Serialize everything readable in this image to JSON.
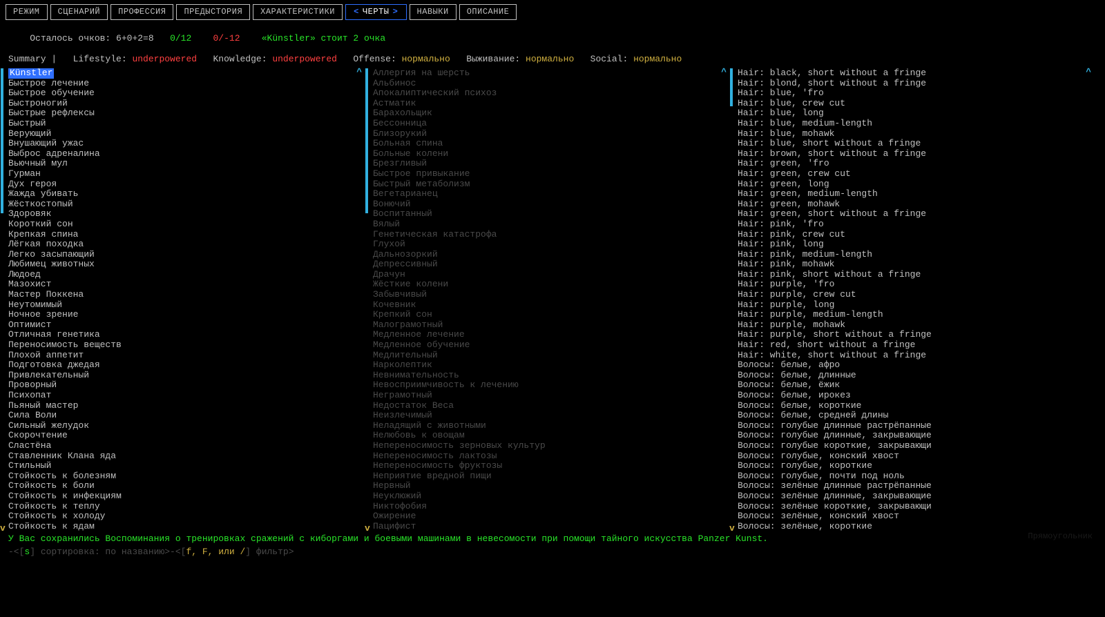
{
  "tabs": [
    {
      "label": "РЕЖИМ",
      "active": false
    },
    {
      "label": "СЦЕНАРИЙ",
      "active": false
    },
    {
      "label": "ПРОФЕССИЯ",
      "active": false
    },
    {
      "label": "ПРЕДЫСТОРИЯ",
      "active": false
    },
    {
      "label": "ХАРАКТЕРИСТИКИ",
      "active": false
    },
    {
      "label": "ЧЕРТЫ",
      "active": true
    },
    {
      "label": "НАВЫКИ",
      "active": false
    },
    {
      "label": "ОПИСАНИЕ",
      "active": false
    }
  ],
  "points": {
    "label": "Осталось очков: ",
    "expr": "6+0+2=8",
    "pos": "0/12",
    "neg": "0/-12",
    "cost": "«Künstler» стоит 2 очка"
  },
  "summary": {
    "prefix": "Summary |",
    "items": [
      {
        "k": "Lifestyle:",
        "v": "underpowered",
        "cls": "r"
      },
      {
        "k": "Knowledge:",
        "v": "underpowered",
        "cls": "r"
      },
      {
        "k": "Offense:",
        "v": "нормально",
        "cls": "y"
      },
      {
        "k": "Выживание:",
        "v": "нормально",
        "cls": "y"
      },
      {
        "k": "Social:",
        "v": "нормально",
        "cls": "y"
      }
    ]
  },
  "columns": {
    "positive": [
      {
        "t": "Künstler",
        "sel": true
      },
      {
        "t": "Быстрое лечение"
      },
      {
        "t": "Быстрое обучение"
      },
      {
        "t": "Быстроногий"
      },
      {
        "t": "Быстрые рефлексы"
      },
      {
        "t": "Быстрый"
      },
      {
        "t": "Верующий"
      },
      {
        "t": "Внушающий ужас"
      },
      {
        "t": "Выброс адреналина"
      },
      {
        "t": "Вьючный мул"
      },
      {
        "t": "Гурман"
      },
      {
        "t": "Дух героя"
      },
      {
        "t": "Жажда убивать"
      },
      {
        "t": "Жёсткостопый"
      },
      {
        "t": "Здоровяк"
      },
      {
        "t": "Короткий сон"
      },
      {
        "t": "Крепкая спина"
      },
      {
        "t": "Лёгкая походка"
      },
      {
        "t": "Легко засыпающий"
      },
      {
        "t": "Любимец животных"
      },
      {
        "t": "Людоед"
      },
      {
        "t": "Мазохист"
      },
      {
        "t": "Мастер Поккена"
      },
      {
        "t": "Неутомимый"
      },
      {
        "t": "Ночное зрение"
      },
      {
        "t": "Оптимист"
      },
      {
        "t": "Отличная генетика"
      },
      {
        "t": "Переносимость веществ"
      },
      {
        "t": "Плохой аппетит"
      },
      {
        "t": "Подготовка джедая"
      },
      {
        "t": "Привлекательный"
      },
      {
        "t": "Проворный"
      },
      {
        "t": "Психопат"
      },
      {
        "t": "Пьяный мастер"
      },
      {
        "t": "Сила Воли"
      },
      {
        "t": "Сильный желудок"
      },
      {
        "t": "Скорочтение"
      },
      {
        "t": "Сластёна"
      },
      {
        "t": "Ставленник Клана яда"
      },
      {
        "t": "Стильный"
      },
      {
        "t": "Стойкость к болезням"
      },
      {
        "t": "Стойкость к боли"
      },
      {
        "t": "Стойкость к инфекциям"
      },
      {
        "t": "Стойкость к теплу"
      },
      {
        "t": "Стойкость к холоду"
      },
      {
        "t": "Стойкость к ядам"
      }
    ],
    "negative": [
      {
        "t": "Аллергия на шерсть"
      },
      {
        "t": "Альбинос"
      },
      {
        "t": "Апокалиптический психоз"
      },
      {
        "t": "Астматик"
      },
      {
        "t": "Барахольщик"
      },
      {
        "t": "Бессонница"
      },
      {
        "t": "Близорукий"
      },
      {
        "t": "Больная спина"
      },
      {
        "t": "Больные колени"
      },
      {
        "t": "Брезгливый"
      },
      {
        "t": "Быстрое привыкание"
      },
      {
        "t": "Быстрый метаболизм"
      },
      {
        "t": "Вегетарианец"
      },
      {
        "t": "Вонючий"
      },
      {
        "t": "Воспитанный"
      },
      {
        "t": "Вялый"
      },
      {
        "t": "Генетическая катастрофа"
      },
      {
        "t": "Глухой"
      },
      {
        "t": "Дальнозоркий"
      },
      {
        "t": "Депрессивный"
      },
      {
        "t": "Драчун"
      },
      {
        "t": "Жёсткие колени"
      },
      {
        "t": "Забывчивый"
      },
      {
        "t": "Кочевник"
      },
      {
        "t": "Крепкий сон"
      },
      {
        "t": "Малограмотный"
      },
      {
        "t": "Медленное лечение"
      },
      {
        "t": "Медленное обучение"
      },
      {
        "t": "Медлительный"
      },
      {
        "t": "Нарколептик"
      },
      {
        "t": "Невнимательность"
      },
      {
        "t": "Невосприимчивость к лечению"
      },
      {
        "t": "Неграмотный"
      },
      {
        "t": "Недостаток Веса"
      },
      {
        "t": "Неизлечимый"
      },
      {
        "t": "Неладящий с животными"
      },
      {
        "t": "Нелюбовь к овощам"
      },
      {
        "t": "Непереносимость зерновых культур"
      },
      {
        "t": "Непереносимость лактозы"
      },
      {
        "t": "Непереносимость фруктозы"
      },
      {
        "t": "Неприятие вредной пищи"
      },
      {
        "t": "Нервный"
      },
      {
        "t": "Неуклюжий"
      },
      {
        "t": "Никтофобия"
      },
      {
        "t": "Ожирение"
      },
      {
        "t": "Пацифист"
      }
    ],
    "cosmetic": [
      {
        "t": "Hair: black, short without a fringe"
      },
      {
        "t": "Hair: blond, short without a fringe"
      },
      {
        "t": "Hair: blue, 'fro"
      },
      {
        "t": "Hair: blue, crew cut"
      },
      {
        "t": "Hair: blue, long"
      },
      {
        "t": "Hair: blue, medium-length"
      },
      {
        "t": "Hair: blue, mohawk"
      },
      {
        "t": "Hair: blue, short without a fringe"
      },
      {
        "t": "Hair: brown, short without a fringe"
      },
      {
        "t": "Hair: green, 'fro"
      },
      {
        "t": "Hair: green, crew cut"
      },
      {
        "t": "Hair: green, long"
      },
      {
        "t": "Hair: green, medium-length"
      },
      {
        "t": "Hair: green, mohawk"
      },
      {
        "t": "Hair: green, short without a fringe"
      },
      {
        "t": "Hair: pink, 'fro"
      },
      {
        "t": "Hair: pink, crew cut"
      },
      {
        "t": "Hair: pink, long"
      },
      {
        "t": "Hair: pink, medium-length"
      },
      {
        "t": "Hair: pink, mohawk"
      },
      {
        "t": "Hair: pink, short without a fringe"
      },
      {
        "t": "Hair: purple, 'fro"
      },
      {
        "t": "Hair: purple, crew cut"
      },
      {
        "t": "Hair: purple, long"
      },
      {
        "t": "Hair: purple, medium-length"
      },
      {
        "t": "Hair: purple, mohawk"
      },
      {
        "t": "Hair: purple, short without a fringe"
      },
      {
        "t": "Hair: red, short without a fringe"
      },
      {
        "t": "Hair: white, short without a fringe"
      },
      {
        "t": "Волосы: белые, афро"
      },
      {
        "t": "Волосы: белые, длинные"
      },
      {
        "t": "Волосы: белые, ёжик"
      },
      {
        "t": "Волосы: белые, ирокез"
      },
      {
        "t": "Волосы: белые, короткие"
      },
      {
        "t": "Волосы: белые, средней длины"
      },
      {
        "t": "Волосы: голубые длинные растрёпанные"
      },
      {
        "t": "Волосы: голубые длинные, закрывающие"
      },
      {
        "t": "Волосы: голубые короткие, закрывающи"
      },
      {
        "t": "Волосы: голубые, конский хвост"
      },
      {
        "t": "Волосы: голубые, короткие"
      },
      {
        "t": "Волосы: голубые, почти под ноль"
      },
      {
        "t": "Волосы: зелёные длинные растрёпанные"
      },
      {
        "t": "Волосы: зелёные длинные, закрывающие"
      },
      {
        "t": "Волосы: зелёные короткие, закрывающи"
      },
      {
        "t": "Волосы: зелёные, конский хвост"
      },
      {
        "t": "Волосы: зелёные, короткие"
      }
    ]
  },
  "scroll": {
    "up_glyph": "^",
    "down_glyph": "v"
  },
  "description": "У Вас сохранились Воспоминания о тренировках сражений с киборгами и боевыми машинами в невесомости при помощи тайного искусства Panzer Kunst.",
  "footer": {
    "sort_open": "-<[",
    "sort_key": "s",
    "sort_mid": "] сортировка: по названию>-<[",
    "filter_keys": "f, F, или /",
    "filter_end": "] фильтр>"
  },
  "phantom": "Прямоугольник"
}
